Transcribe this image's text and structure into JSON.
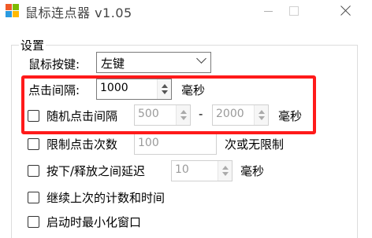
{
  "window": {
    "title": "鼠标连点器 v1.05"
  },
  "settings_group": {
    "title": "设置"
  },
  "hotkey": {
    "label": "鼠标按键:",
    "value": "左键"
  },
  "interval": {
    "label": "点击间隔:",
    "value": "1000",
    "unit": "毫秒"
  },
  "random_interval": {
    "label": "随机点击间隔",
    "min": "500",
    "separator": "-",
    "max": "2000",
    "unit": "毫秒",
    "checked": false
  },
  "limit_clicks": {
    "label": "限制点击次数",
    "value": "100",
    "suffix": "次或无限制",
    "checked": false
  },
  "press_release_delay": {
    "label": "按下/释放之间延迟",
    "value": "10",
    "unit": "毫秒",
    "checked": false
  },
  "resume_count": {
    "label": "继续上次的计数和时间",
    "checked": false
  },
  "start_minimized": {
    "label": "启动时最小化窗口",
    "checked": false
  },
  "annotation": {
    "color": "#ff1a1a"
  }
}
